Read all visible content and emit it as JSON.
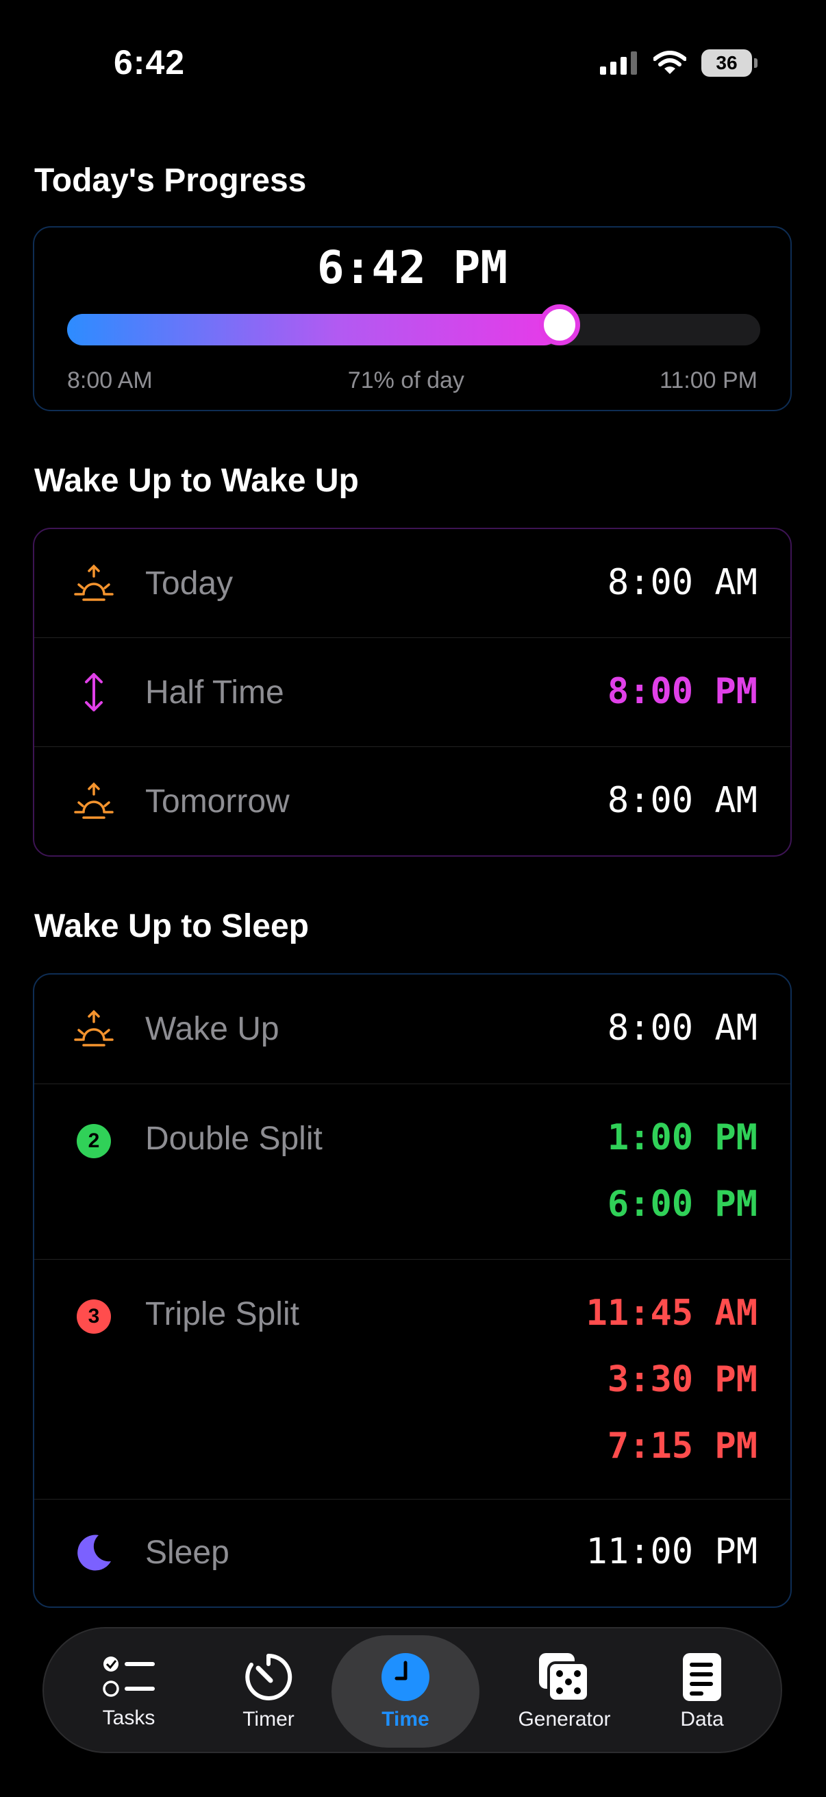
{
  "status_bar": {
    "time": "6:42",
    "battery": "36"
  },
  "progress": {
    "title": "Today's Progress",
    "current_time": "6:42 PM",
    "fraction": 0.71,
    "start_label": "8:00 AM",
    "percent_label": "71% of day",
    "end_label": "11:00 PM"
  },
  "wake_to_wake": {
    "title": "Wake Up to Wake Up",
    "rows": [
      {
        "label": "Today",
        "time": "8:00 AM",
        "icon": "sunrise-icon"
      },
      {
        "label": "Half Time",
        "time": "8:00 PM",
        "icon": "vertical-arrows-icon"
      },
      {
        "label": "Tomorrow",
        "time": "8:00 AM",
        "icon": "sunrise-icon"
      }
    ]
  },
  "wake_to_sleep": {
    "title": "Wake Up to Sleep",
    "wake": {
      "label": "Wake Up",
      "time": "8:00 AM",
      "icon": "sunrise-icon"
    },
    "double": {
      "label": "Double Split",
      "badge": "2",
      "times": [
        "1:00 PM",
        "6:00 PM"
      ]
    },
    "triple": {
      "label": "Triple Split",
      "badge": "3",
      "times": [
        "11:45 AM",
        "3:30 PM",
        "7:15 PM"
      ]
    },
    "sleep": {
      "label": "Sleep",
      "time": "11:00 PM",
      "icon": "moon-icon"
    }
  },
  "tabs": [
    {
      "label": "Tasks",
      "icon": "checklist-icon"
    },
    {
      "label": "Timer",
      "icon": "timer-icon"
    },
    {
      "label": "Time",
      "icon": "clock-icon",
      "active": true
    },
    {
      "label": "Generator",
      "icon": "dice-icon"
    },
    {
      "label": "Data",
      "icon": "document-icon"
    }
  ],
  "colors": {
    "accent_blue": "#1e90ff",
    "half_time": "#e040e8",
    "double_split": "#30d158",
    "triple_split": "#ff4d4d",
    "sunrise": "#f5942e",
    "moon": "#7b61ff"
  }
}
